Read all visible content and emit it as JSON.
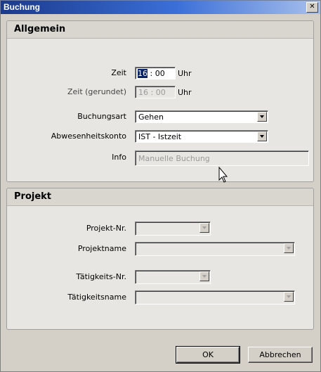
{
  "window": {
    "title": "Buchung",
    "close_glyph": "✕"
  },
  "allgemein": {
    "title": "Allgemein",
    "zeit_label": "Zeit",
    "zeit_hours": "16",
    "zeit_sep": ":",
    "zeit_minutes": "00",
    "zeit_unit": "Uhr",
    "zeit_gerundet_label": "Zeit (gerundet)",
    "zeit_gerundet_value": "16 : 00",
    "zeit_gerundet_unit": "Uhr",
    "buchungsart_label": "Buchungsart",
    "buchungsart_value": "Gehen",
    "abwesenheitskonto_label": "Abwesenheitskonto",
    "abwesenheitskonto_value": "IST - Istzeit",
    "info_label": "Info",
    "info_value": "Manuelle Buchung"
  },
  "projekt": {
    "title": "Projekt",
    "projekt_nr_label": "Projekt-Nr.",
    "projektname_label": "Projektname",
    "taetigkeits_nr_label": "Tätigkeits-Nr.",
    "taetigkeitsname_label": "Tätigkeitsname"
  },
  "buttons": {
    "ok": "OK",
    "cancel": "Abbrechen"
  },
  "icons": {
    "close": "close-icon",
    "dropdown": "chevron-down-icon",
    "cursor": "mouse-pointer-icon"
  }
}
